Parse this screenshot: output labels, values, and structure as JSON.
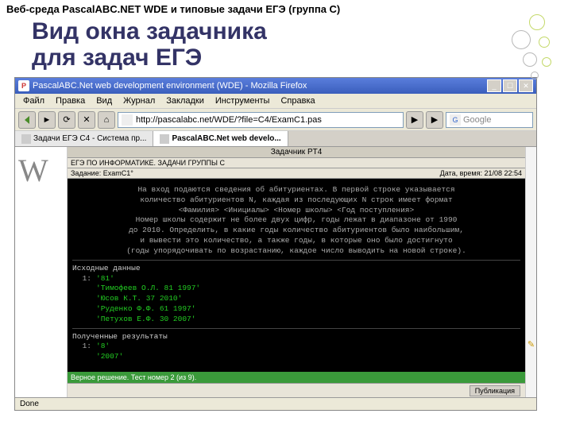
{
  "slide": {
    "header": "Веб-среда PascalABC.NET WDE и типовые задачи ЕГЭ (группа C)",
    "title_l1": "Вид окна задачника",
    "title_l2": "для задач ЕГЭ"
  },
  "window": {
    "title": "PascalABC.Net web development environment (WDE) - Mozilla Firefox",
    "min": "_",
    "max": "☐",
    "close": "✕"
  },
  "menus": [
    "Файл",
    "Правка",
    "Вид",
    "Журнал",
    "Закладки",
    "Инструменты",
    "Справка"
  ],
  "nav": {
    "back": "◄",
    "fwd": "►",
    "reload": "⟳",
    "stop": "✕",
    "home": "⌂",
    "url": "http://pascalabc.net/WDE/?file=C4/ExamC1.pas",
    "go": "▶",
    "go2": "▶",
    "search_placeholder": "Google",
    "search_icon": "G"
  },
  "tabs": {
    "t0": "Задачи ЕГЭ C4 - Система пр...",
    "t1": "PascalABC.Net web develo..."
  },
  "sidebar_w": "W",
  "task": {
    "top": "Задачник PT4",
    "header": "ЕГЭ ПО ИНФОРМАТИКЕ. ЗАДАЧИ ГРУППЫ C",
    "left": "Задание: ExamC1°",
    "right": "Дата, время: 21/08 22:54"
  },
  "terminal": {
    "desc1": "На вход подаются сведения об абитуриентах. В первой строке указывается",
    "desc2": "количество абитуриентов N, каждая из последующих N строк имеет формат",
    "desc3": "<Фамилия> <Инициалы> <Номер школы> <Год поступления>",
    "desc4": "Номер школы содержит не более двух цифр, годы лежат в диапазоне от 1990",
    "desc5": "до 2010. Определить, в какие годы количество абитуриентов было наибольшим,",
    "desc6": "и вывести это количество, а также годы, в которые оно было достигнуто",
    "desc7": "(годы упорядочивать по возрастанию, каждое число выводить на новой строке).",
    "src_h": "Исходные данные",
    "src": [
      "'81'",
      "'Тимофеев О.Л. 81 1997'",
      "'Юсов К.Т. 37 2010'",
      "'Руденко Ф.Ф. 61 1997'",
      "'Петухов Е.Ф. 30 2007'"
    ],
    "res_h": "Полученные результаты",
    "res": [
      "'8'",
      "'2007'"
    ]
  },
  "result_bar": "Верное решение. Тест номер 2 (из 9).",
  "pub_btn": "Публикация",
  "status": "Done"
}
